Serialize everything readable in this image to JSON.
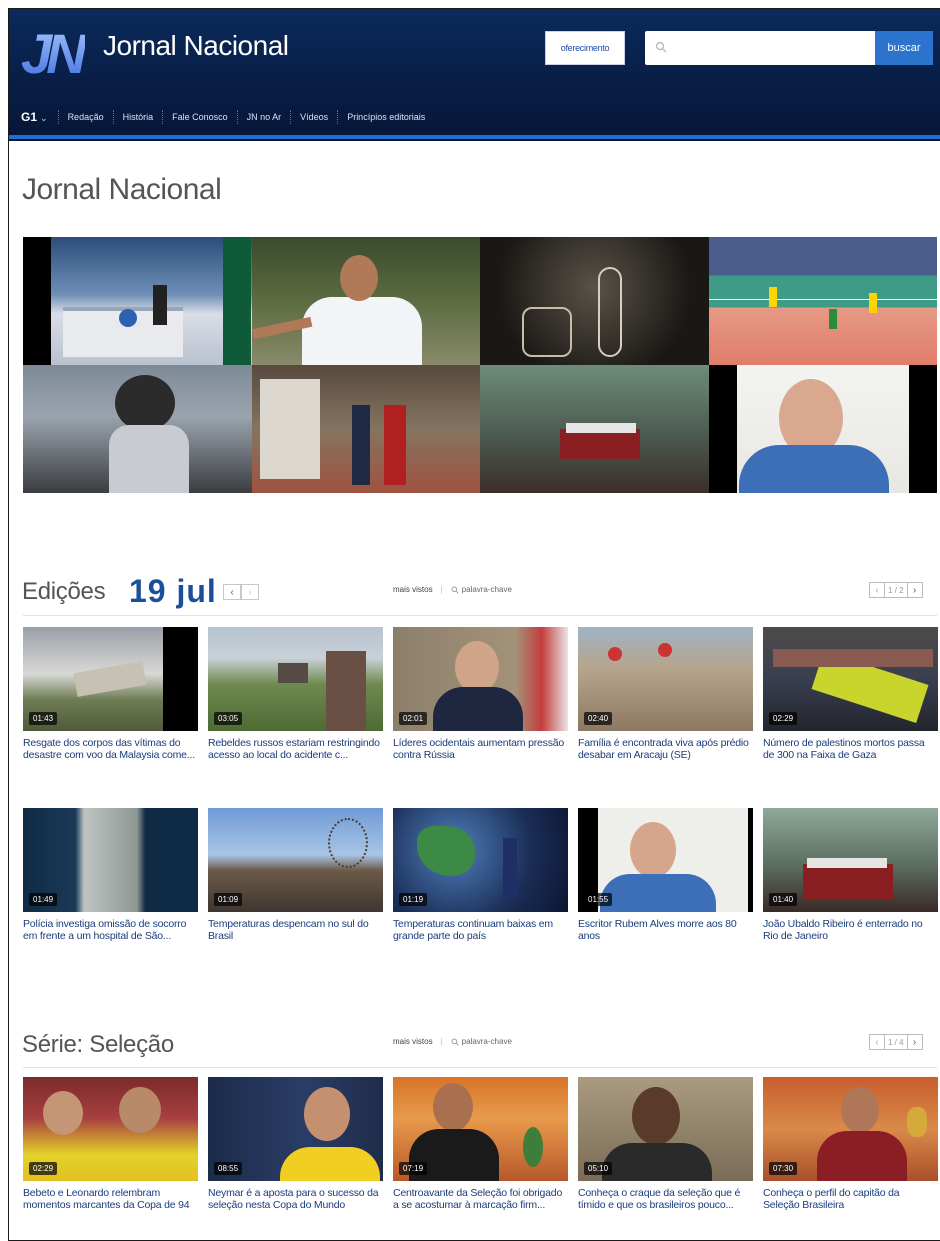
{
  "header": {
    "brand": "Jornal Nacional",
    "ad_label": "oferecimento",
    "search_placeholder": "",
    "search_button": "buscar",
    "nav": {
      "g1": "G1",
      "g1_chevron": "⌄",
      "items": [
        "Redação",
        "História",
        "Fale Conosco",
        "JN no Ar",
        "Vídeos",
        "Princípios editoriais"
      ]
    }
  },
  "page_title": "Jornal Nacional",
  "edicoes": {
    "title": "Edições",
    "date": "19 jul",
    "prev": "‹",
    "next": "›",
    "mais_vistos": "mais vistos",
    "keyword": "palavra-chave",
    "page": "1 / 2",
    "videos": [
      {
        "dur": "01:43",
        "title": "Resgate dos corpos das vítimas do desastre com voo da Malaysia come..."
      },
      {
        "dur": "03:05",
        "title": "Rebeldes russos estariam restringindo acesso ao local do acidente c..."
      },
      {
        "dur": "02:01",
        "title": "Líderes ocidentais aumentam pressão contra Rússia"
      },
      {
        "dur": "02:40",
        "title": "Família é encontrada viva após prédio desabar em Aracaju (SE)"
      },
      {
        "dur": "02:29",
        "title": "Número de palestinos mortos passa de 300 na Faixa de Gaza"
      },
      {
        "dur": "01:49",
        "title": "Polícia investiga omissão de socorro em frente a um hospital de São..."
      },
      {
        "dur": "01:09",
        "title": "Temperaturas despencam no sul do Brasil"
      },
      {
        "dur": "01:19",
        "title": "Temperaturas continuam baixas em grande parte do país"
      },
      {
        "dur": "01:55",
        "title": "Escritor Rubem Alves morre aos 80 anos"
      },
      {
        "dur": "01:40",
        "title": "João Ubaldo Ribeiro é enterrado no Rio de Janeiro"
      }
    ]
  },
  "serie": {
    "title": "Série: Seleção",
    "mais_vistos": "mais vistos",
    "keyword": "palavra-chave",
    "page": "1 / 4",
    "prev": "‹",
    "next": "›",
    "videos": [
      {
        "dur": "02:29",
        "title": "Bebeto e Leonardo relembram momentos marcantes da Copa de 94"
      },
      {
        "dur": "08:55",
        "title": "Neymar é a aposta para o sucesso da seleção nesta Copa do Mundo"
      },
      {
        "dur": "07:19",
        "title": "Centroavante da Seleção foi obrigado a se acostumar à marcação firm..."
      },
      {
        "dur": "05:10",
        "title": "Conheça o craque da seleção que é tímido e que os brasileiros pouco..."
      },
      {
        "dur": "07:30",
        "title": "Conheça o perfil do capitão da Seleção Brasileira"
      }
    ]
  },
  "colors": {
    "header": "#0b2a5c",
    "accent": "#1f6fd1",
    "link": "#1a3d7c"
  }
}
